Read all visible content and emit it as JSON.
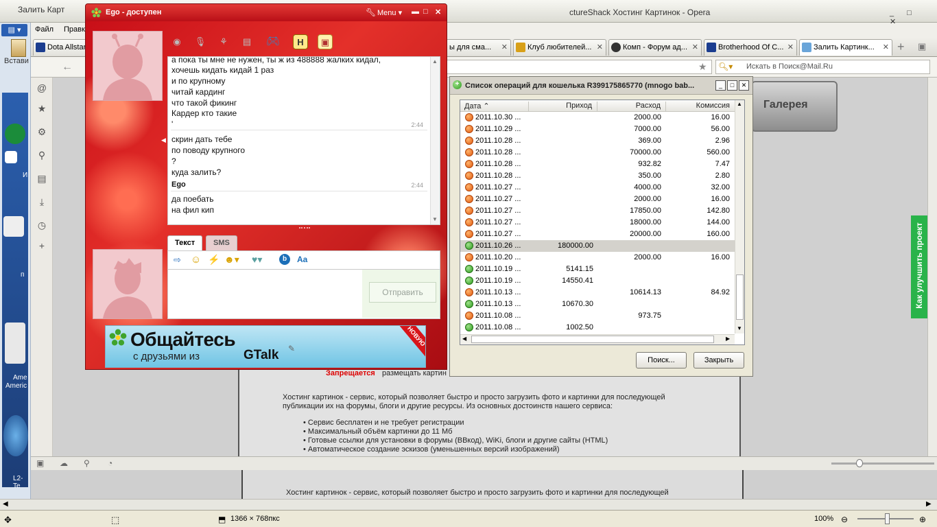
{
  "paint": {
    "title_left": "Залить Карт",
    "menu_file": "Файл",
    "menu_edit": "Правк",
    "paste_label": "Встави",
    "desktop_labels": [
      "И",
      "п",
      "Ame",
      "Americ",
      "L2-Te"
    ],
    "status_size": "1366 × 768пкс",
    "zoom": "100%"
  },
  "opera": {
    "title_right": "ctureShack Хостинг Картинок - Opera",
    "tabs": [
      {
        "label": "Dota Allstar",
        "color": "#1b3d8f"
      },
      {
        "label": "ы для сма...",
        "color": "#cccccc"
      },
      {
        "label": "Клуб любителей...",
        "color": "#d8a018"
      },
      {
        "label": "Комп - Форум ад...",
        "color": "#333333"
      },
      {
        "label": "Brotherhood Of C...",
        "color": "#1b3d8f"
      },
      {
        "label": "Залить Картинк...",
        "color": "#6aa5d9"
      }
    ],
    "search_placeholder": "Искать в Поиск@Mail.Ru",
    "gallery_label": "Галерея",
    "improve_label": "Как улучшить проект",
    "page": {
      "forbidden_word": "Запрещается",
      "forbidden_rest": "размещать картин",
      "intro_line1": "Хостинг картинок - сервис, который позволяет быстро и просто загрузить фото и картинки для последующей",
      "intro_line2": "публикации их на форумы, блоги и другие ресурсы. Из основных достоинств нашего сервиса:",
      "bullets": [
        "Сервис бесплатен и не требует регистрации",
        "Максимальный объём картинки до 11 Мб",
        "Готовые ссылки для установки в форумы (ВВкод), WiKi, блоги и другие сайты (HTML)",
        "Автоматическое создание эскизов (уменьшенных версий изображений)"
      ],
      "lower_intro": "Хостинг картинок - сервис, который позволяет быстро и просто загрузить фото и картинки для последующей"
    }
  },
  "icq": {
    "title": "Ego - доступен",
    "menu_label": "Menu",
    "messages": [
      {
        "lines": [
          "а пока ты мне не нужен, ты ж из 488888 жалких кидал,",
          "хочешь кидать кидай 1 раз",
          "и по крупному",
          "читай кардинг",
          "что такой фикинг",
          "Кардер кто такие",
          "'"
        ],
        "time": "2:44"
      },
      {
        "lines": [
          "скрин дать тебе",
          "по поводу крупного",
          "?",
          "куда залить?"
        ],
        "author": "Ego",
        "time": "2:44"
      },
      {
        "lines": [
          "да поебать",
          "на фил кип"
        ]
      }
    ],
    "tab_text": "Текст",
    "tab_sms": "SMS",
    "send_label": "Отправить",
    "banner": {
      "headline": "Общайтесь",
      "sub": "с друзьями из",
      "brand": "GTalk",
      "ribbon": "НОВУЮ"
    }
  },
  "wallet": {
    "title": "Список операций для кошелька R399175865770 (mnogo bab...",
    "columns": [
      "Дата",
      "Приход",
      "Расход",
      "Комиссия"
    ],
    "rows": [
      {
        "date": "2011.10.30 ...",
        "in": "",
        "out": "2000.00",
        "fee": "16.00",
        "dir": "out"
      },
      {
        "date": "2011.10.29 ...",
        "in": "",
        "out": "7000.00",
        "fee": "56.00",
        "dir": "out"
      },
      {
        "date": "2011.10.28 ...",
        "in": "",
        "out": "369.00",
        "fee": "2.96",
        "dir": "out"
      },
      {
        "date": "2011.10.28 ...",
        "in": "",
        "out": "70000.00",
        "fee": "560.00",
        "dir": "out"
      },
      {
        "date": "2011.10.28 ...",
        "in": "",
        "out": "932.82",
        "fee": "7.47",
        "dir": "out"
      },
      {
        "date": "2011.10.28 ...",
        "in": "",
        "out": "350.00",
        "fee": "2.80",
        "dir": "out"
      },
      {
        "date": "2011.10.27 ...",
        "in": "",
        "out": "4000.00",
        "fee": "32.00",
        "dir": "out"
      },
      {
        "date": "2011.10.27 ...",
        "in": "",
        "out": "2000.00",
        "fee": "16.00",
        "dir": "out"
      },
      {
        "date": "2011.10.27 ...",
        "in": "",
        "out": "17850.00",
        "fee": "142.80",
        "dir": "out"
      },
      {
        "date": "2011.10.27 ...",
        "in": "",
        "out": "18000.00",
        "fee": "144.00",
        "dir": "out"
      },
      {
        "date": "2011.10.27 ...",
        "in": "",
        "out": "20000.00",
        "fee": "160.00",
        "dir": "out"
      },
      {
        "date": "2011.10.26 ...",
        "in": "180000.00",
        "out": "",
        "fee": "",
        "dir": "in",
        "selected": true
      },
      {
        "date": "2011.10.20 ...",
        "in": "",
        "out": "2000.00",
        "fee": "16.00",
        "dir": "out"
      },
      {
        "date": "2011.10.19 ...",
        "in": "5141.15",
        "out": "",
        "fee": "",
        "dir": "in"
      },
      {
        "date": "2011.10.19 ...",
        "in": "14550.41",
        "out": "",
        "fee": "",
        "dir": "in"
      },
      {
        "date": "2011.10.13 ...",
        "in": "",
        "out": "10614.13",
        "fee": "84.92",
        "dir": "out"
      },
      {
        "date": "2011.10.13 ...",
        "in": "10670.30",
        "out": "",
        "fee": "",
        "dir": "in"
      },
      {
        "date": "2011.10.08 ...",
        "in": "",
        "out": "973.75",
        "fee": "",
        "dir": "out"
      },
      {
        "date": "2011.10.08 ...",
        "in": "1002.50",
        "out": "",
        "fee": "",
        "dir": "in"
      }
    ],
    "search_button": "Поиск...",
    "close_button": "Закрыть"
  }
}
